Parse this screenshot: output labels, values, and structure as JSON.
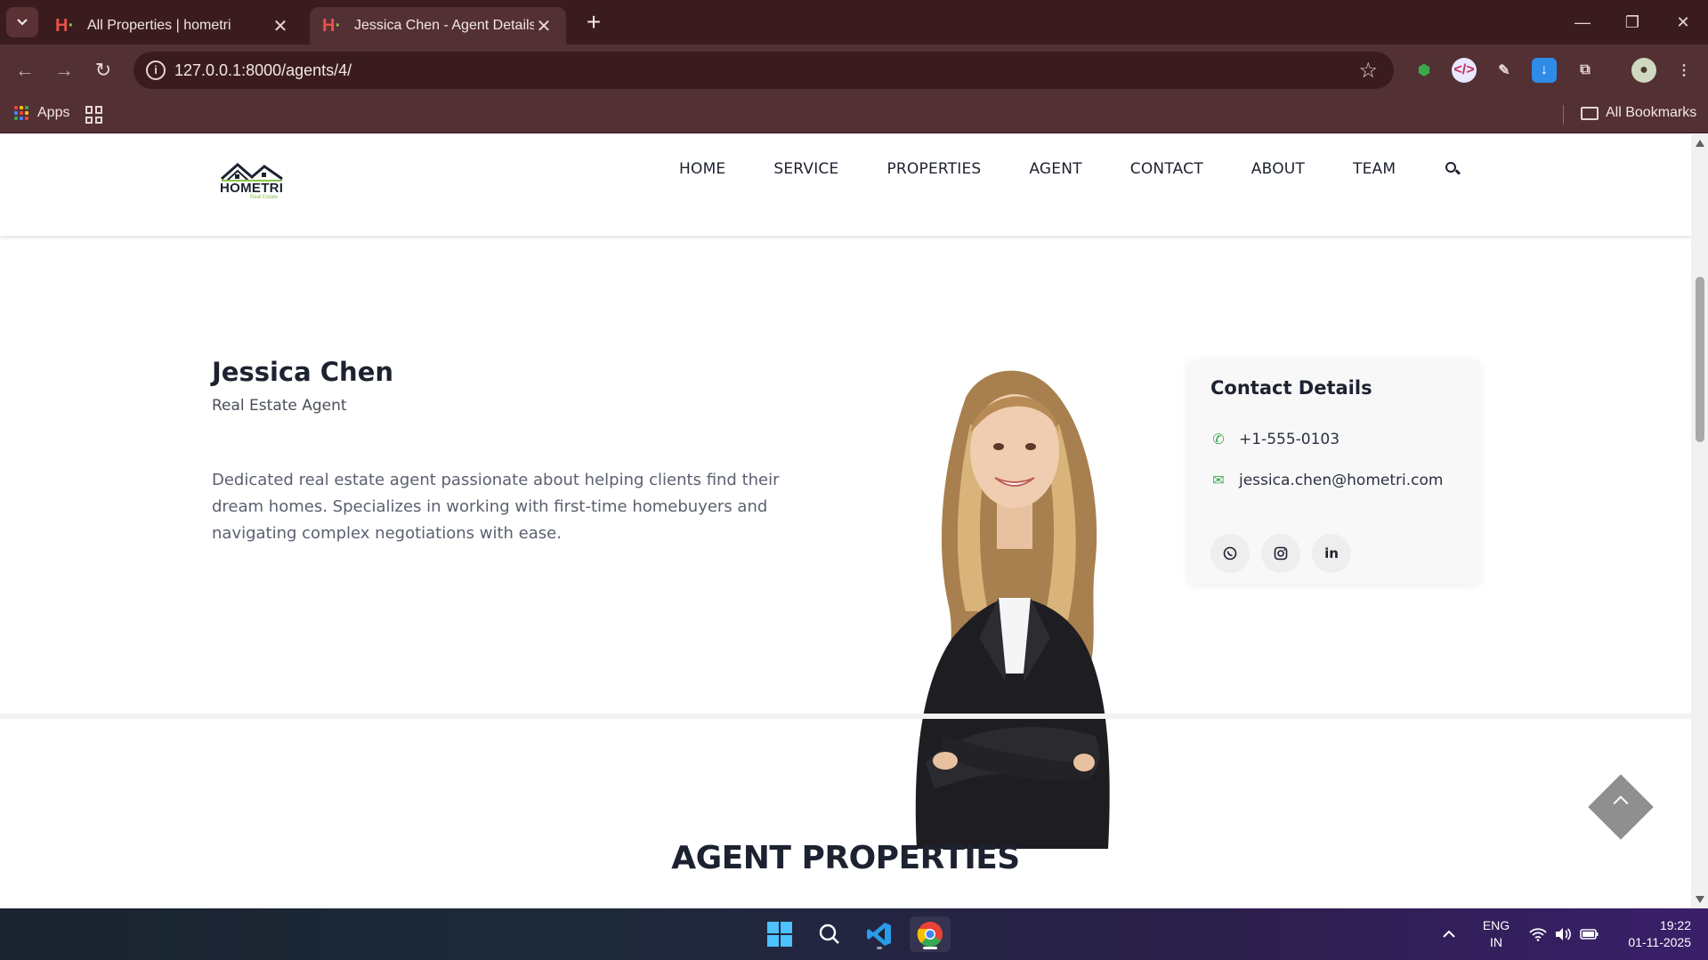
{
  "browser": {
    "tabs": [
      {
        "title": "All Properties | hometri",
        "active": false
      },
      {
        "title": "Jessica Chen - Agent Details | hometri",
        "active": true
      }
    ],
    "url": "127.0.0.1:8000/agents/4/",
    "bookmarks": {
      "apps_label": "Apps",
      "all_bookmarks_label": "All Bookmarks"
    }
  },
  "site": {
    "logo_text": "HOMETRI",
    "logo_sub": "Real Estate",
    "nav": [
      "HOME",
      "SERVICE",
      "PROPERTIES",
      "AGENT",
      "CONTACT",
      "ABOUT",
      "TEAM"
    ]
  },
  "agent": {
    "name": "Jessica Chen",
    "role": "Real Estate Agent",
    "bio": "Dedicated real estate agent passionate about helping clients find their dream homes. Specializes in working with first-time homebuyers and navigating complex negotiations with ease."
  },
  "contact": {
    "title": "Contact Details",
    "phone": "+1-555-0103",
    "email": "jessica.chen@hometri.com",
    "socials": [
      "whatsapp-icon",
      "instagram-icon",
      "linkedin-icon"
    ],
    "accent_color": "#3aa94a"
  },
  "section": {
    "title": "AGENT PROPERTIES"
  },
  "taskbar": {
    "lang_top": "ENG",
    "lang_bottom": "IN",
    "time": "19:22",
    "date": "01-11-2025"
  }
}
